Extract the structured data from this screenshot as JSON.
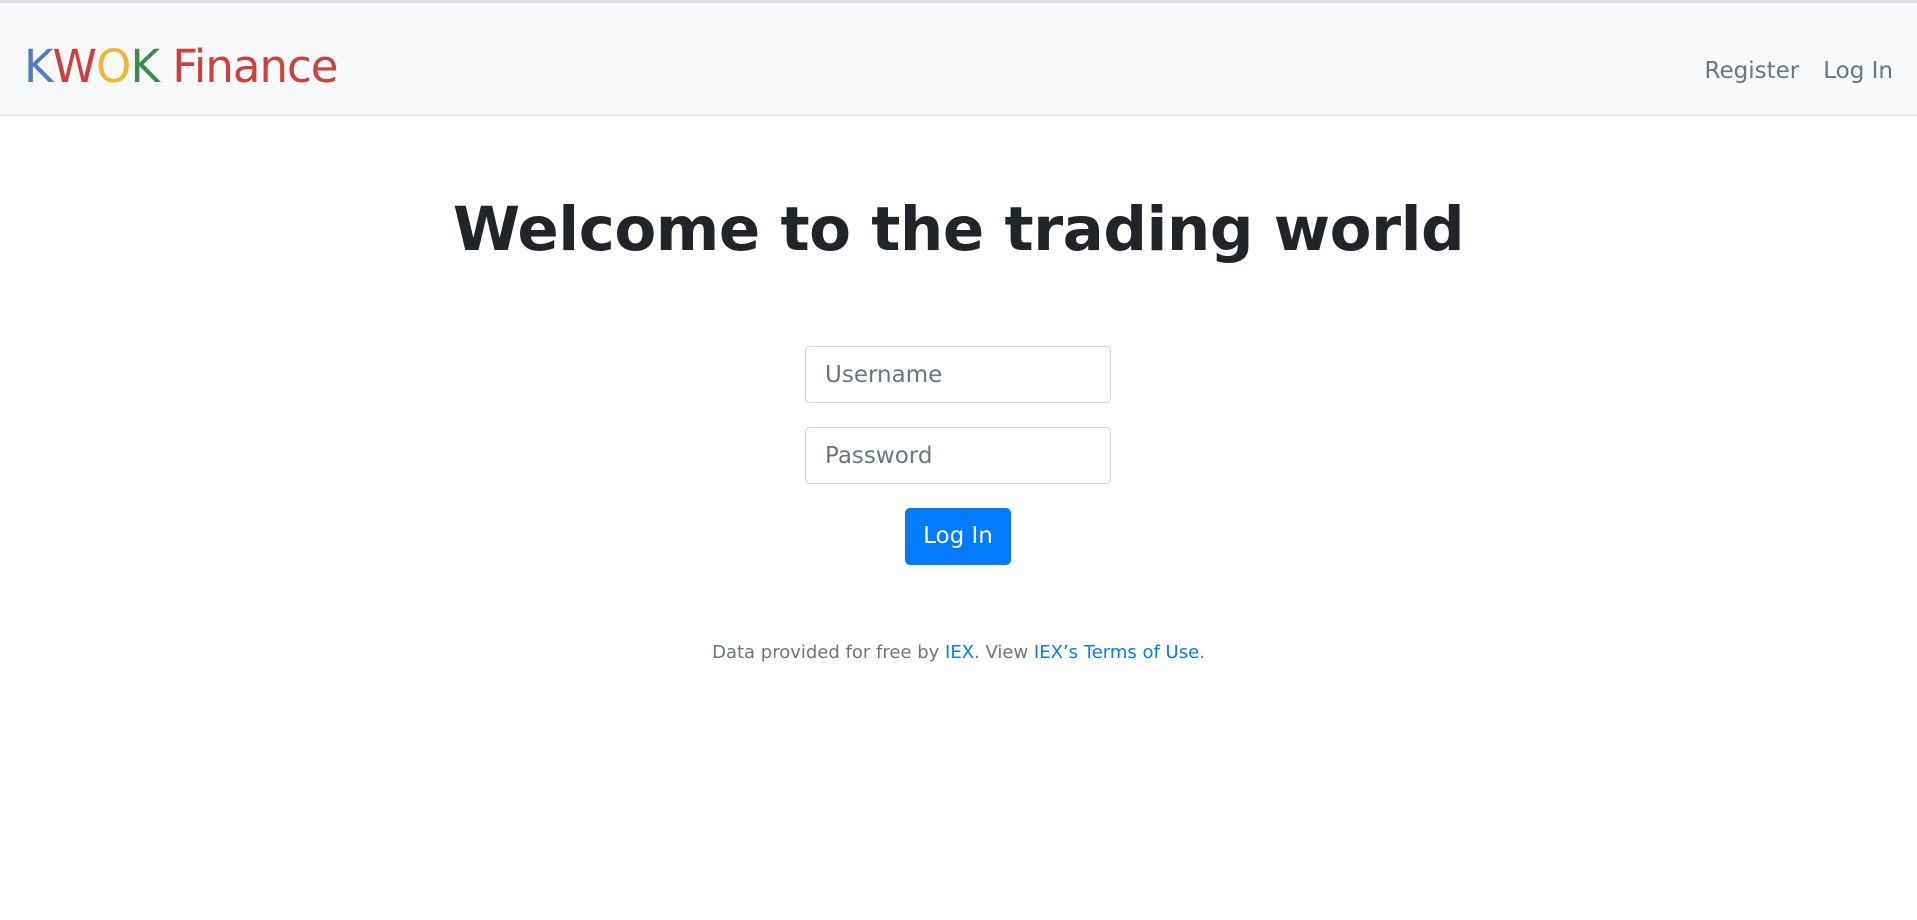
{
  "navbar": {
    "brand": {
      "letters": [
        {
          "text": "K",
          "color": "#537bc4"
        },
        {
          "text": "W",
          "color": "#d03e3e"
        },
        {
          "text": "O",
          "color": "#f0b732"
        },
        {
          "text": "K",
          "color": "#3b8d4c"
        },
        {
          "text": " Finance",
          "color": "#d03e3e"
        }
      ]
    },
    "links": {
      "register": "Register",
      "login": "Log In"
    }
  },
  "main": {
    "headline": "Welcome to the trading world",
    "form": {
      "username_placeholder": "Username",
      "username_value": "",
      "password_placeholder": "Password",
      "password_value": "",
      "submit_label": "Log In"
    }
  },
  "footer": {
    "text_before": "Data provided for free by ",
    "iex_link": "IEX",
    "text_middle": ". View ",
    "terms_link": "IEX’s Terms of Use",
    "text_after": "."
  },
  "colors": {
    "primary": "#007bff",
    "navbar_bg": "#f8f9fa",
    "muted_text": "#6c757d",
    "heading_text": "#212529"
  }
}
